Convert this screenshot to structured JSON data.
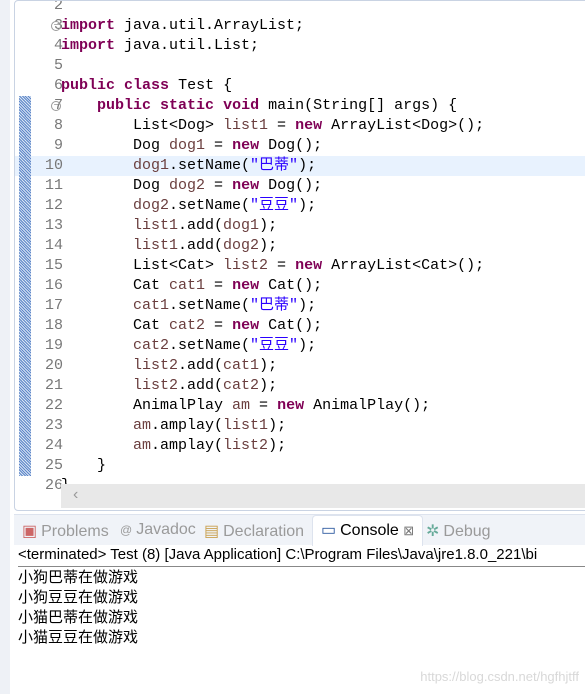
{
  "editor": {
    "highlighted_line": 10,
    "lines": [
      {
        "n": "2",
        "t": []
      },
      {
        "n": "3",
        "fold": true,
        "t": [
          [
            "kw",
            "import"
          ],
          [
            "",
            "java.util.ArrayList;"
          ]
        ]
      },
      {
        "n": "4",
        "t": [
          [
            "kw",
            "import"
          ],
          [
            "",
            "java.util.List;"
          ]
        ]
      },
      {
        "n": "5",
        "t": []
      },
      {
        "n": "6",
        "t": [
          [
            "kw",
            "public"
          ],
          [
            "kw",
            "class"
          ],
          [
            "",
            "Test {"
          ]
        ]
      },
      {
        "n": "7",
        "fold": true,
        "marker": true,
        "t": [
          [
            "",
            "    "
          ],
          [
            "kw",
            "public"
          ],
          [
            "kw",
            "static"
          ],
          [
            "kw",
            "void"
          ],
          [
            "",
            "main(String[] args) {"
          ]
        ]
      },
      {
        "n": "8",
        "marker": true,
        "t": [
          [
            "",
            "        List<Dog> "
          ],
          [
            "var",
            "list1"
          ],
          [
            "",
            " = "
          ],
          [
            "kw",
            "new"
          ],
          [
            "",
            "ArrayList<Dog>();"
          ]
        ]
      },
      {
        "n": "9",
        "marker": true,
        "t": [
          [
            "",
            "        Dog "
          ],
          [
            "var",
            "dog1"
          ],
          [
            "",
            " = "
          ],
          [
            "kw",
            "new"
          ],
          [
            "",
            "Dog();"
          ]
        ]
      },
      {
        "n": "10",
        "marker": true,
        "t": [
          [
            "",
            "        "
          ],
          [
            "var",
            "dog1"
          ],
          [
            "",
            ".setName("
          ],
          [
            "str",
            "\"巴蒂\""
          ],
          [
            "",
            ");"
          ]
        ]
      },
      {
        "n": "11",
        "marker": true,
        "t": [
          [
            "",
            "        Dog "
          ],
          [
            "var",
            "dog2"
          ],
          [
            "",
            " = "
          ],
          [
            "kw",
            "new"
          ],
          [
            "",
            "Dog();"
          ]
        ]
      },
      {
        "n": "12",
        "marker": true,
        "t": [
          [
            "",
            "        "
          ],
          [
            "var",
            "dog2"
          ],
          [
            "",
            ".setName("
          ],
          [
            "str",
            "\"豆豆\""
          ],
          [
            "",
            ");"
          ]
        ]
      },
      {
        "n": "13",
        "marker": true,
        "t": [
          [
            "",
            "        "
          ],
          [
            "var",
            "list1"
          ],
          [
            "",
            ".add("
          ],
          [
            "var",
            "dog1"
          ],
          [
            "",
            ");"
          ]
        ]
      },
      {
        "n": "14",
        "marker": true,
        "t": [
          [
            "",
            "        "
          ],
          [
            "var",
            "list1"
          ],
          [
            "",
            ".add("
          ],
          [
            "var",
            "dog2"
          ],
          [
            "",
            ");"
          ]
        ]
      },
      {
        "n": "15",
        "marker": true,
        "t": [
          [
            "",
            "        List<Cat> "
          ],
          [
            "var",
            "list2"
          ],
          [
            "",
            " = "
          ],
          [
            "kw",
            "new"
          ],
          [
            "",
            "ArrayList<Cat>();"
          ]
        ]
      },
      {
        "n": "16",
        "marker": true,
        "t": [
          [
            "",
            "        Cat "
          ],
          [
            "var",
            "cat1"
          ],
          [
            "",
            " = "
          ],
          [
            "kw",
            "new"
          ],
          [
            "",
            "Cat();"
          ]
        ]
      },
      {
        "n": "17",
        "marker": true,
        "t": [
          [
            "",
            "        "
          ],
          [
            "var",
            "cat1"
          ],
          [
            "",
            ".setName("
          ],
          [
            "str",
            "\"巴蒂\""
          ],
          [
            "",
            ");"
          ]
        ]
      },
      {
        "n": "18",
        "marker": true,
        "t": [
          [
            "",
            "        Cat "
          ],
          [
            "var",
            "cat2"
          ],
          [
            "",
            " = "
          ],
          [
            "kw",
            "new"
          ],
          [
            "",
            "Cat();"
          ]
        ]
      },
      {
        "n": "19",
        "marker": true,
        "t": [
          [
            "",
            "        "
          ],
          [
            "var",
            "cat2"
          ],
          [
            "",
            ".setName("
          ],
          [
            "str",
            "\"豆豆\""
          ],
          [
            "",
            ");"
          ]
        ]
      },
      {
        "n": "20",
        "marker": true,
        "t": [
          [
            "",
            "        "
          ],
          [
            "var",
            "list2"
          ],
          [
            "",
            ".add("
          ],
          [
            "var",
            "cat1"
          ],
          [
            "",
            ");"
          ]
        ]
      },
      {
        "n": "21",
        "marker": true,
        "t": [
          [
            "",
            "        "
          ],
          [
            "var",
            "list2"
          ],
          [
            "",
            ".add("
          ],
          [
            "var",
            "cat2"
          ],
          [
            "",
            ");"
          ]
        ]
      },
      {
        "n": "22",
        "marker": true,
        "t": [
          [
            "",
            "        AnimalPlay "
          ],
          [
            "var",
            "am"
          ],
          [
            "",
            " = "
          ],
          [
            "kw",
            "new"
          ],
          [
            "",
            "AnimalPlay();"
          ]
        ]
      },
      {
        "n": "23",
        "marker": true,
        "t": [
          [
            "",
            "        "
          ],
          [
            "var",
            "am"
          ],
          [
            "",
            ".amplay("
          ],
          [
            "var",
            "list1"
          ],
          [
            "",
            ");"
          ]
        ]
      },
      {
        "n": "24",
        "marker": true,
        "t": [
          [
            "",
            "        "
          ],
          [
            "var",
            "am"
          ],
          [
            "",
            ".amplay("
          ],
          [
            "var",
            "list2"
          ],
          [
            "",
            ");"
          ]
        ]
      },
      {
        "n": "25",
        "marker": true,
        "t": [
          [
            "",
            "    }"
          ]
        ]
      },
      {
        "n": "26",
        "t": [
          [
            "",
            "}"
          ]
        ]
      }
    ]
  },
  "tabs": {
    "problems": "Problems",
    "javadoc": "Javadoc",
    "declaration": "Declaration",
    "console": "Console",
    "close": "⊠",
    "debug": "Debug"
  },
  "console": {
    "status": "<terminated> Test (8) [Java Application] C:\\Program Files\\Java\\jre1.8.0_221\\bi",
    "output": [
      "小狗巴蒂在做游戏",
      "小狗豆豆在做游戏",
      "小猫巴蒂在做游戏",
      "小猫豆豆在做游戏"
    ]
  },
  "watermark": "https://blog.csdn.net/hgfhjtff"
}
